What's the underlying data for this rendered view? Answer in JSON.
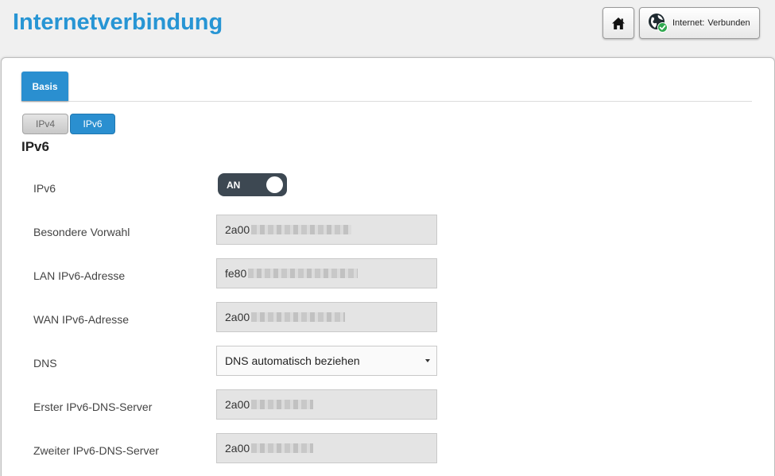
{
  "header": {
    "title": "Internetverbindung",
    "status_prefix": "Internet:",
    "status_value": "Verbunden",
    "home_icon": "home-icon",
    "status_icon": "globe-connected-icon"
  },
  "tabs": [
    {
      "label": "Basis",
      "active": true
    }
  ],
  "subtabs": [
    {
      "label": "IPv4",
      "active": false
    },
    {
      "label": "IPv6",
      "active": true
    }
  ],
  "section": {
    "title": "IPv6",
    "ipv6": {
      "label": "IPv6",
      "toggle_text": "AN"
    },
    "prefix": {
      "label": "Besondere Vorwahl",
      "value": "2a00"
    },
    "lan_address": {
      "label": "LAN IPv6-Adresse",
      "value": "fe80"
    },
    "wan_address": {
      "label": "WAN IPv6-Adresse",
      "value": "2a00"
    },
    "dns": {
      "label": "DNS",
      "selected": "DNS automatisch beziehen"
    },
    "dns1": {
      "label": "Erster IPv6-DNS-Server",
      "value": "2a00"
    },
    "dns2": {
      "label": "Zweiter IPv6-DNS-Server",
      "value": "2a00"
    }
  },
  "colors": {
    "accent": "#2a8fd0",
    "title": "#2795d4",
    "toggle_bg": "#3d4852",
    "status_ok": "#2fa84f"
  }
}
